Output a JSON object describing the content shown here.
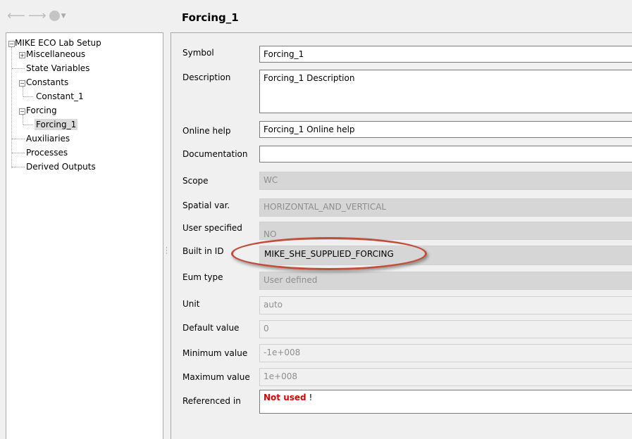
{
  "header": {
    "title": "Forcing_1"
  },
  "tree": {
    "root": "MIKE ECO Lab Setup",
    "items": {
      "misc": "Miscellaneous",
      "state": "State Variables",
      "constants": "Constants",
      "constant1": "Constant_1",
      "forcing": "Forcing",
      "forcing1": "Forcing_1",
      "aux": "Auxiliaries",
      "processes": "Processes",
      "derived": "Derived Outputs"
    }
  },
  "form": {
    "symbol": {
      "label": "Symbol",
      "value": "Forcing_1"
    },
    "description": {
      "label": "Description",
      "value": "Forcing_1 Description"
    },
    "online_help": {
      "label": "Online help",
      "value": "Forcing_1 Online help"
    },
    "documentation": {
      "label": "Documentation",
      "value": ""
    },
    "scope": {
      "label": "Scope",
      "value": "WC"
    },
    "spatial": {
      "label": "Spatial var.",
      "value": "HORIZONTAL_AND_VERTICAL"
    },
    "user_specified": {
      "label": "User specified",
      "value": "NO"
    },
    "built_in_id": {
      "label": "Built in ID",
      "value": "MIKE_SHE_SUPPLIED_FORCING"
    },
    "eum_type": {
      "label": "Eum type",
      "value": "User defined"
    },
    "unit": {
      "label": "Unit",
      "value": "auto"
    },
    "default_value": {
      "label": "Default value",
      "value": "0"
    },
    "min_value": {
      "label": "Minimum value",
      "value": "-1e+008"
    },
    "max_value": {
      "label": "Maximum value",
      "value": "1e+008"
    },
    "referenced_in": {
      "label": "Referenced in",
      "value": "Not used",
      "suffix": " !"
    }
  },
  "colors": {
    "highlight_ellipse": "#c04e3a",
    "not_used": "#e00000"
  }
}
